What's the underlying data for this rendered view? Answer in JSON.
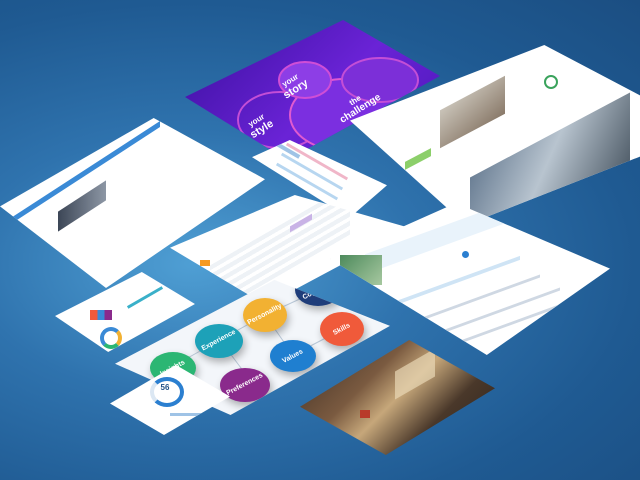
{
  "purple_card": {
    "story": [
      "your",
      "story"
    ],
    "style": [
      "your",
      "style"
    ],
    "challenge": [
      "the",
      "challenge"
    ]
  },
  "skills_map": {
    "bubbles": [
      {
        "label": "Personality",
        "color": "#f2b132"
      },
      {
        "label": "Cognition",
        "color": "#3a8ad6"
      },
      {
        "label": "Skills",
        "color": "#f05a3a"
      },
      {
        "label": "Experience",
        "color": "#1da1b8"
      },
      {
        "label": "Values",
        "color": "#1f7fd0"
      },
      {
        "label": "Preferences",
        "color": "#8a2a8c"
      },
      {
        "label": "Insights",
        "color": "#2bb673"
      }
    ]
  },
  "gauge_card": {
    "value": "56"
  },
  "colors": {
    "purple": "#5a1fc4",
    "blue_bg": "#2f73ae"
  }
}
